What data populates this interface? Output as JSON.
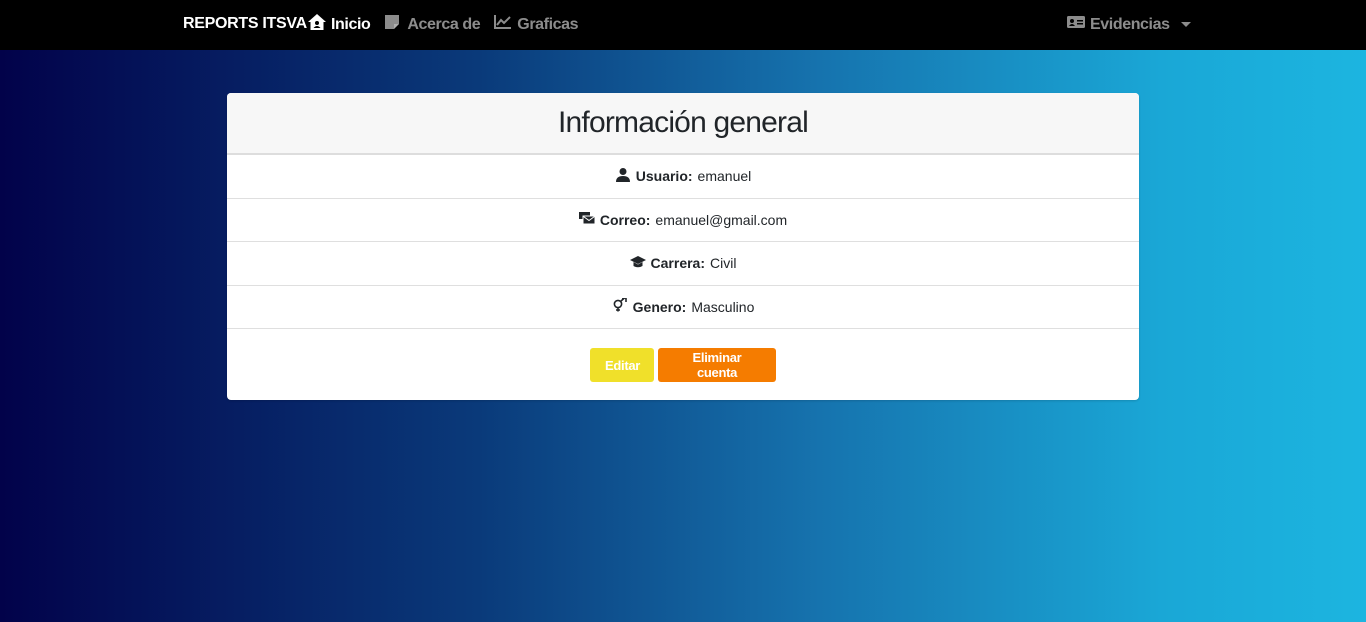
{
  "navbar": {
    "brand": "REPORTS ITSVA",
    "links": [
      {
        "label": "Inicio",
        "icon": "house-user-icon",
        "active": true
      },
      {
        "label": "Acerca de",
        "icon": "note-icon",
        "active": false
      },
      {
        "label": "Graficas",
        "icon": "chart-line-icon",
        "active": false
      }
    ],
    "dropdown": {
      "label": "Evidencias",
      "icon": "id-card-icon"
    }
  },
  "card": {
    "title": "Información general",
    "fields": [
      {
        "icon": "user-icon",
        "label": "Usuario:",
        "value": "emanuel"
      },
      {
        "icon": "mail-bulk-icon",
        "label": "Correo:",
        "value": "emanuel@gmail.com"
      },
      {
        "icon": "graduation-cap-icon",
        "label": "Carrera:",
        "value": "Civil"
      },
      {
        "icon": "venus-mars-icon",
        "label": "Genero:",
        "value": "Masculino"
      }
    ],
    "buttons": {
      "edit": "Editar",
      "delete": "Eliminar cuenta"
    }
  },
  "colors": {
    "navbar": "#000000",
    "edit_button": "#f0e02a",
    "delete_button": "#f57c00",
    "gradient_start": "#02024a",
    "gradient_end": "#1cb5e0"
  }
}
